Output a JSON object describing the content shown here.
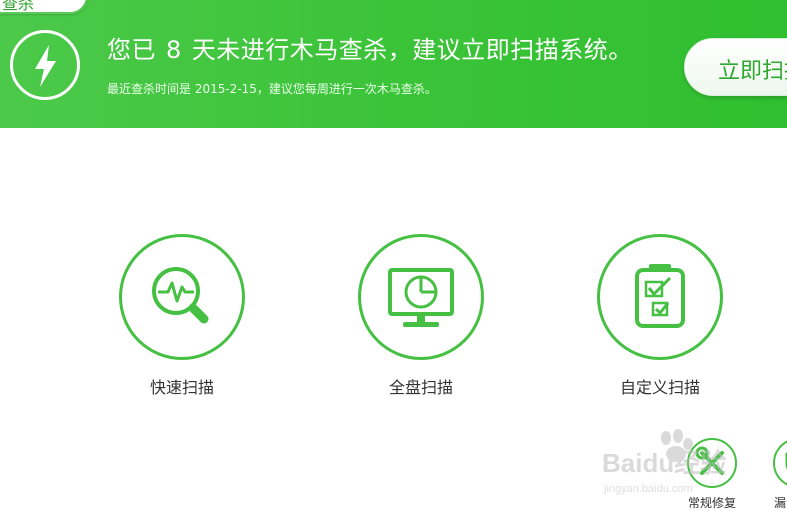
{
  "header": {
    "back_tab_label": "查杀",
    "title_prefix": "您已",
    "days": "8",
    "title_suffix": "天未进行木马查杀，建议立即扫描系统。",
    "subtitle": "最近查杀时间是 2015-2-15，建议您每周进行一次木马查杀。",
    "scan_now_label": "立即扫描"
  },
  "scan_options": [
    {
      "label": "快速扫描",
      "icon": "magnifier-pulse-icon"
    },
    {
      "label": "全盘扫描",
      "icon": "monitor-pie-icon"
    },
    {
      "label": "自定义扫描",
      "icon": "clipboard-check-icon"
    }
  ],
  "tools": [
    {
      "label": "常规修复",
      "icon": "wrench-screwdriver-icon"
    },
    {
      "label": "漏洞修复",
      "icon": "shield-icon"
    }
  ],
  "watermark": {
    "text": "Baidu经验",
    "url_text": "jingyan.baidu.com"
  },
  "colors": {
    "banner_green": "#3dc43a",
    "accent_green": "#45c043",
    "text_dark": "#333333"
  }
}
